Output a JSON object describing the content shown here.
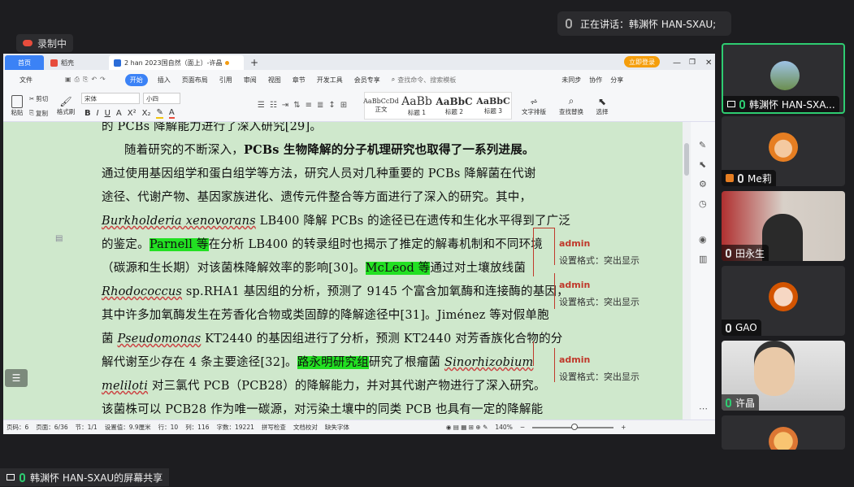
{
  "meeting": {
    "speaking_label": "正在讲话：韩渊怀 HAN-SXAU;",
    "recording_label": "录制中",
    "screen_share_label": "韩渊怀 HAN-SXAU的屏幕共享",
    "participants": [
      {
        "name": "韩渊怀 HAN-SXA...",
        "active": true
      },
      {
        "name": "Me莉",
        "active": false
      },
      {
        "name": "田永生",
        "active": false
      },
      {
        "name": "GAO",
        "active": false
      },
      {
        "name": "许晶",
        "active": false
      }
    ]
  },
  "wps": {
    "tabs": {
      "home": "首页",
      "wps": "稻壳",
      "doc": "2 han 2023国自然（面上）-许晶"
    },
    "login_button": "立即登录",
    "menu": [
      "文件",
      "开始",
      "插入",
      "页面布局",
      "引用",
      "审阅",
      "视图",
      "章节",
      "开发工具",
      "会员专享"
    ],
    "search_placeholder": "查找命令、搜索模板",
    "right_actions": [
      "未同步",
      "协作",
      "分享"
    ],
    "clipboard": {
      "paste": "粘贴",
      "cut": "剪切",
      "copy": "复制",
      "format_painter": "格式刷"
    },
    "font_name": "宋体",
    "font_size": "小四",
    "styles": [
      {
        "preview": "AaBbCcDd",
        "label": "正文"
      },
      {
        "preview": "AaBb",
        "label": "标题 1"
      },
      {
        "preview": "AaBbC",
        "label": "标题 2"
      },
      {
        "preview": "AaBbC",
        "label": "标题 3"
      }
    ],
    "text_layout": "文字排版",
    "find_replace": "查找替换",
    "select": "选择",
    "doc_lines": {
      "l0": "的 PCBs 降解能力进行了深入研究[29]。",
      "l1a": "随着研究的不断深入，",
      "l1b": "PCBs 生物降解的分子机理研究也取得了一系列进展。",
      "l2": "通过使用基因组学和蛋白组学等方法，研究人员对几种重要的 PCBs 降解菌在代谢",
      "l3": "途径、代谢产物、基因家族进化、遗传元件整合等方面进行了深入的研究。其中，",
      "l4a": "Burkholderia xenovorans",
      "l4b": " LB400 降解 PCBs 的途径已在遗传和生化水平得到了广泛",
      "l5a": "的鉴定。",
      "l5b": "Parnell 等",
      "l5c": "在分析 LB400 的转录组时也揭示了推定的解毒机制和不同环境",
      "l6a": "（碳源和生长期）对该菌株降解效率的影响[30]。",
      "l6b": "McLeod 等",
      "l6c": "通过对土壤放线菌",
      "l7a": "Rhodococcus",
      "l7b": " sp.RHA1 基因组的分析，预测了 9145 个富含加氧酶和连接酶的基因，",
      "l8": "其中许多加氧酶发生在芳香化合物或类固醇的降解途径中[31]。Jiménez 等对假单胞",
      "l9a": "菌 ",
      "l9b": "Pseudomonas",
      "l9c": " KT2440 的基因组进行了分析，预测 KT2440 对芳香族化合物的分",
      "l10a": "解代谢至少存在 4 条主要途径[32]。",
      "l10b": "路永明研究组",
      "l10c": "研究了根瘤菌 ",
      "l10d": "Sinorhizobium",
      "l11a": "meliloti",
      "l11b": " 对三氯代 PCB（PCB28）的降解能力，并对其代谢产物进行了深入研究。",
      "l12": "该菌株可以 PCB28 作为唯一碳源，对污染土壤中的同类 PCB 也具有一定的降解能"
    },
    "comments": [
      {
        "author": "admin",
        "text": "设置格式：突出显示"
      },
      {
        "author": "admin",
        "text": "设置格式：突出显示"
      },
      {
        "author": "admin",
        "text": "设置格式：突出显示"
      }
    ],
    "status": {
      "page_num": "页码：6",
      "pages": "页面：6/36",
      "section": "节：1/1",
      "setting": "设置值：9.9厘米",
      "row": "行：10",
      "col": "列：116",
      "words": "字数：19221",
      "spell": "拼写检查",
      "proof": "文档校对",
      "missing_font": "缺失字体",
      "zoom": "140%"
    }
  }
}
